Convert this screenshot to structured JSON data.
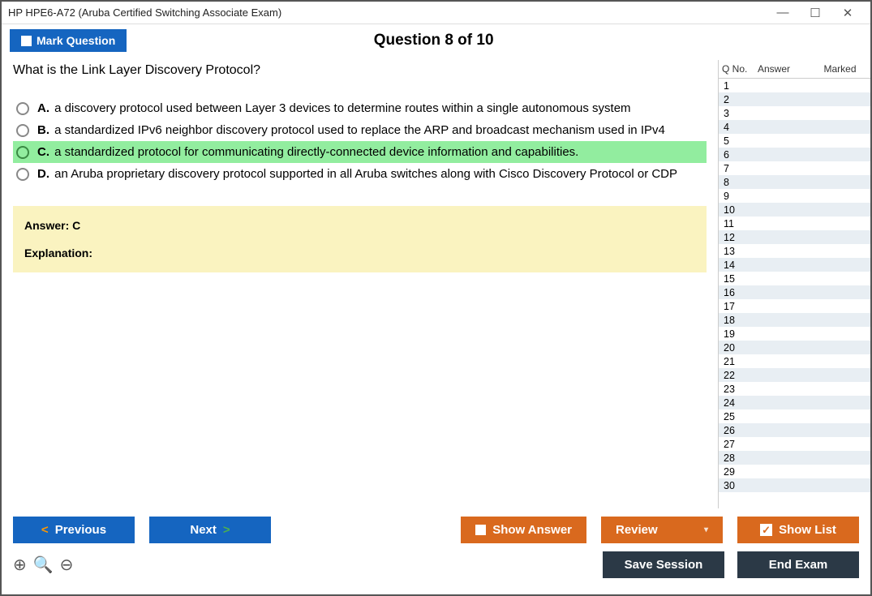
{
  "window": {
    "title": "HP HPE6-A72 (Aruba Certified Switching Associate Exam)"
  },
  "header": {
    "mark_label": "Mark Question",
    "question_counter": "Question 8 of 10"
  },
  "question": {
    "text": "What is the Link Layer Discovery Protocol?",
    "options": [
      {
        "letter": "A.",
        "text": "a discovery protocol used between Layer 3 devices to determine routes within a single autonomous system",
        "selected": false
      },
      {
        "letter": "B.",
        "text": "a standardized IPv6 neighbor discovery protocol used to replace the ARP and broadcast mechanism used in IPv4",
        "selected": false
      },
      {
        "letter": "C.",
        "text": "a standardized protocol for communicating directly-connected device information and capabilities.",
        "selected": true
      },
      {
        "letter": "D.",
        "text": "an Aruba proprietary discovery protocol supported in all Aruba switches along with Cisco Discovery Protocol or CDP",
        "selected": false
      }
    ],
    "answer_label": "Answer: C",
    "explanation_label": "Explanation:"
  },
  "sidebar": {
    "col1": "Q No.",
    "col2": "Answer",
    "col3": "Marked",
    "rows": [
      1,
      2,
      3,
      4,
      5,
      6,
      7,
      8,
      9,
      10,
      11,
      12,
      13,
      14,
      15,
      16,
      17,
      18,
      19,
      20,
      21,
      22,
      23,
      24,
      25,
      26,
      27,
      28,
      29,
      30
    ]
  },
  "buttons": {
    "previous": "Previous",
    "next": "Next",
    "show_answer": "Show Answer",
    "review": "Review",
    "show_list": "Show List",
    "save_session": "Save Session",
    "end_exam": "End Exam"
  }
}
